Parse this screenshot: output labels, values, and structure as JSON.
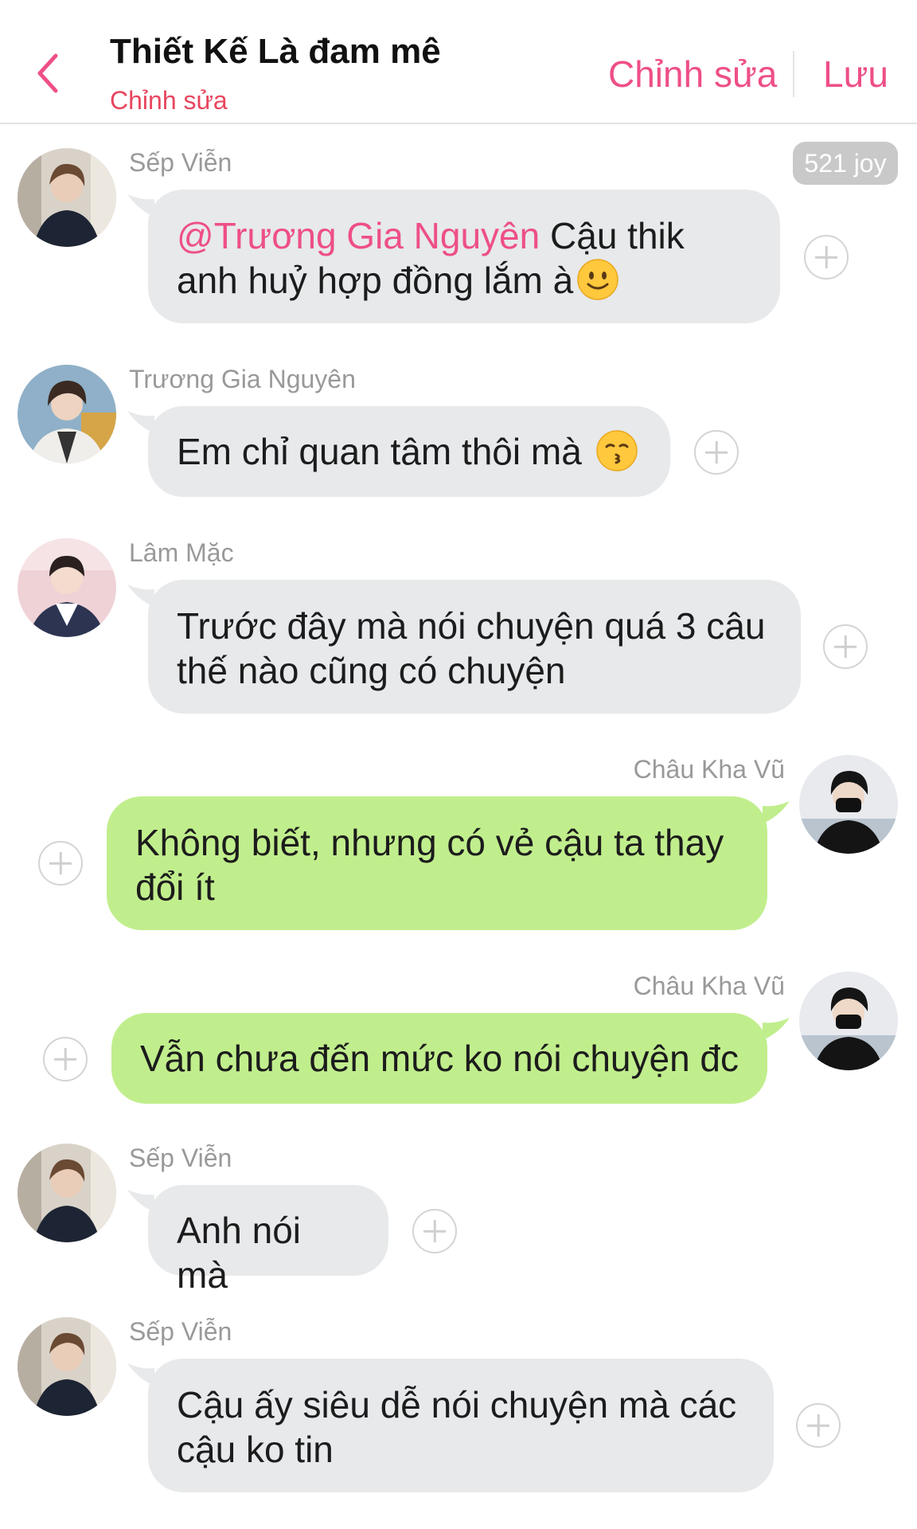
{
  "header": {
    "title": "Thiết Kế Là đam mê",
    "subtitle": "Chỉnh sửa",
    "edit_label": "Chỉnh sửa",
    "save_label": "Lưu"
  },
  "badge": {
    "joy": "521 joy"
  },
  "colors": {
    "accent": "#ee4f88",
    "subtitle": "#e8465e",
    "incoming_bubble": "#e7e9eb",
    "outgoing_bubble": "#c1ee8d"
  },
  "messages": [
    {
      "sender": "Sếp Viễn",
      "mention": "@Trương Gia Nguyên",
      "text": " Cậu thik anh huỷ hợp đồng lắm à",
      "emoji": "slightly-smiling-face",
      "direction": "incoming"
    },
    {
      "sender": "Trương Gia Nguyên",
      "text": "Em chỉ quan tâm thôi mà ",
      "emoji": "kissing-face",
      "direction": "incoming"
    },
    {
      "sender": "Lâm Mặc",
      "text": "Trước đây mà nói chuyện quá 3 câu thế nào cũng có chuyện",
      "direction": "incoming"
    },
    {
      "sender": "Châu Kha Vũ",
      "text": "Không biết, nhưng có vẻ cậu ta thay đổi ít",
      "direction": "outgoing"
    },
    {
      "sender": "Châu Kha Vũ",
      "text": "Vẫn chưa đến mức ko nói chuyện đc",
      "direction": "outgoing"
    },
    {
      "sender": "Sếp Viễn",
      "text": "Anh nói mà",
      "direction": "incoming"
    },
    {
      "sender": "Sếp Viễn",
      "text": "Cậu ấy siêu dễ nói chuyện mà các cậu ko tin",
      "direction": "incoming"
    }
  ]
}
